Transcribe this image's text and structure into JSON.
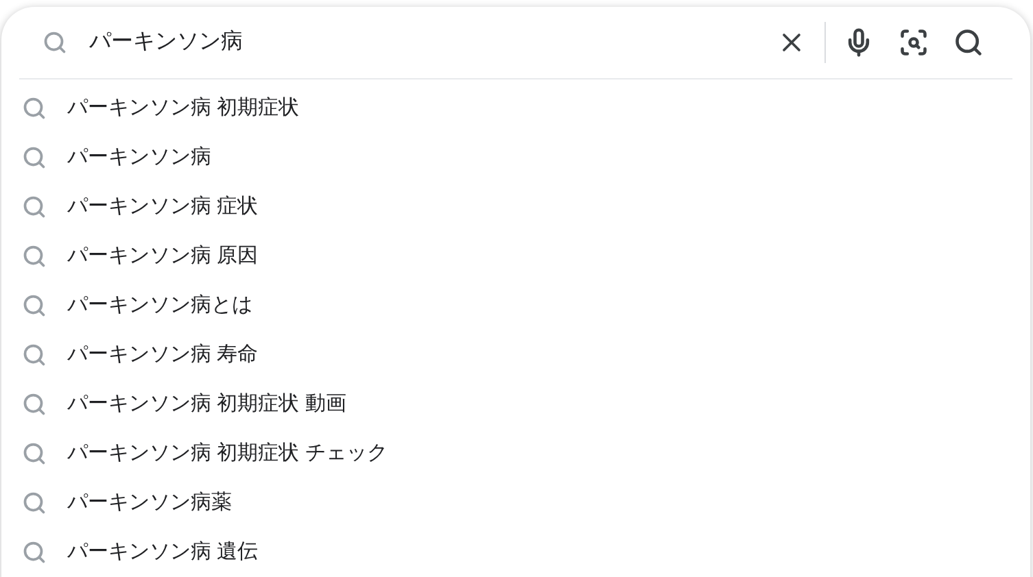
{
  "search": {
    "value": "パーキンソン病"
  },
  "suggestions": [
    "パーキンソン病 初期症状",
    "パーキンソン病",
    "パーキンソン病 症状",
    "パーキンソン病 原因",
    "パーキンソン病とは",
    "パーキンソン病 寿命",
    "パーキンソン病 初期症状 動画",
    "パーキンソン病 初期症状 チェック",
    "パーキンソン病薬",
    "パーキンソン病 遺伝"
  ]
}
